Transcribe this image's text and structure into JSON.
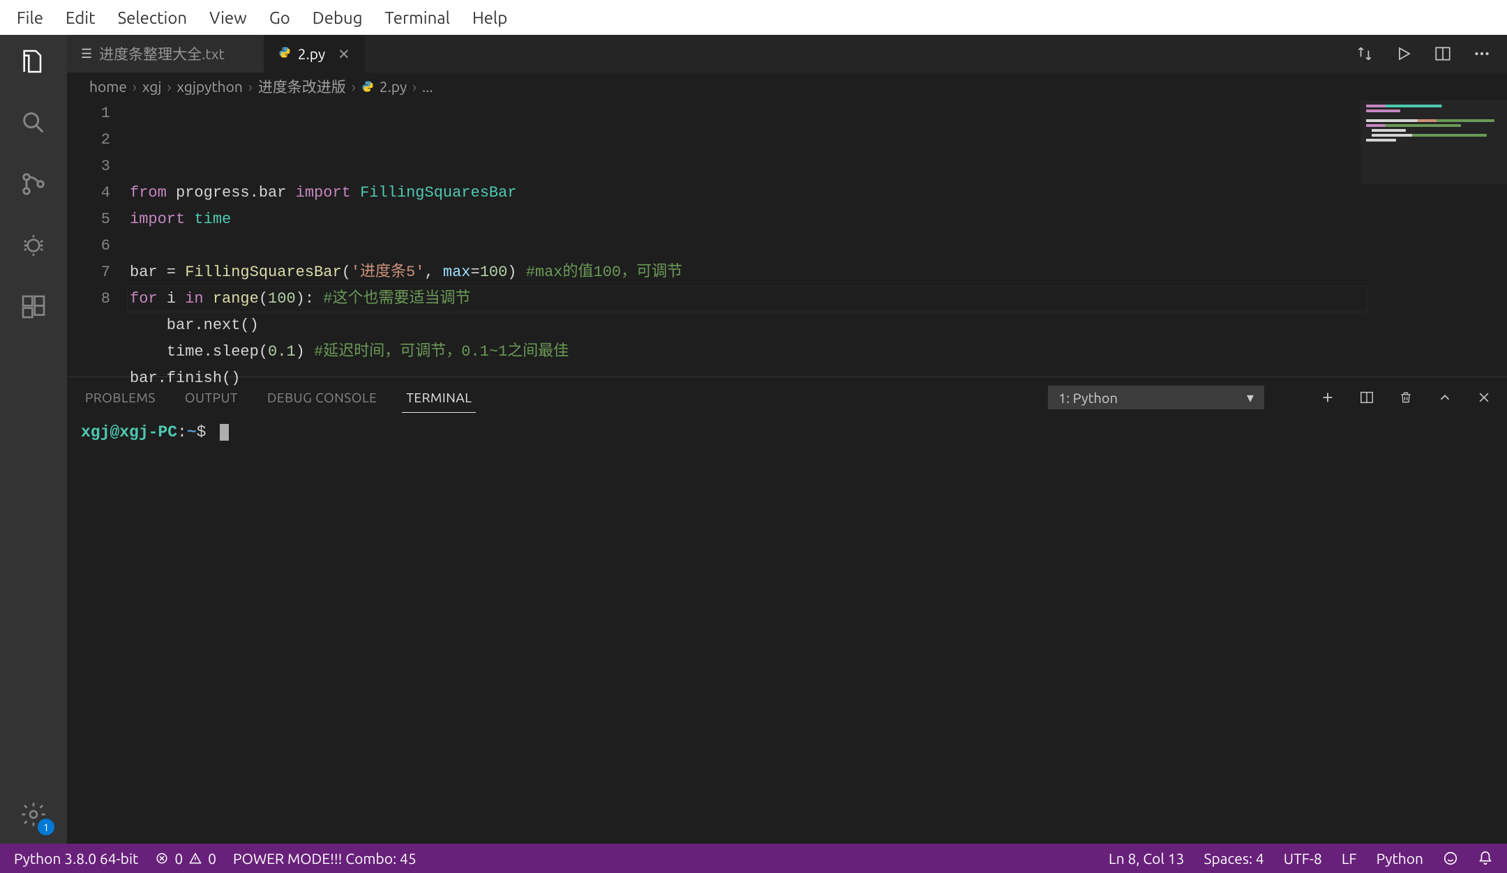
{
  "menu": [
    "File",
    "Edit",
    "Selection",
    "View",
    "Go",
    "Debug",
    "Terminal",
    "Help"
  ],
  "activity_badge": "1",
  "tabs": [
    {
      "label": "进度条整理大全.txt",
      "active": false,
      "icon": "list"
    },
    {
      "label": "2.py",
      "active": true,
      "icon": "python"
    }
  ],
  "breadcrumb": [
    "home",
    "xgj",
    "xgjpython",
    "进度条改进版",
    "2.py",
    "..."
  ],
  "code": {
    "lines": [
      {
        "n": "1",
        "segs": [
          {
            "t": "from ",
            "c": "tk-kw"
          },
          {
            "t": "progress.bar ",
            "c": ""
          },
          {
            "t": "import ",
            "c": "tk-kw"
          },
          {
            "t": "FillingSquaresBar",
            "c": "tk-cls"
          }
        ]
      },
      {
        "n": "2",
        "segs": [
          {
            "t": "import ",
            "c": "tk-kw"
          },
          {
            "t": "time",
            "c": "tk-cls"
          }
        ]
      },
      {
        "n": "3",
        "segs": [
          {
            "t": "",
            "c": ""
          }
        ]
      },
      {
        "n": "4",
        "segs": [
          {
            "t": "bar = ",
            "c": ""
          },
          {
            "t": "FillingSquaresBar",
            "c": "tk-fn"
          },
          {
            "t": "(",
            "c": ""
          },
          {
            "t": "'进度条5'",
            "c": "tk-str"
          },
          {
            "t": ", ",
            "c": ""
          },
          {
            "t": "max",
            "c": "tk-var"
          },
          {
            "t": "=",
            "c": ""
          },
          {
            "t": "100",
            "c": "tk-num"
          },
          {
            "t": ") ",
            "c": ""
          },
          {
            "t": "#max的值100，可调节",
            "c": "tk-cmt"
          }
        ]
      },
      {
        "n": "5",
        "segs": [
          {
            "t": "for ",
            "c": "tk-kw"
          },
          {
            "t": "i ",
            "c": ""
          },
          {
            "t": "in ",
            "c": "tk-kw"
          },
          {
            "t": "range",
            "c": "tk-fn"
          },
          {
            "t": "(",
            "c": ""
          },
          {
            "t": "100",
            "c": "tk-num"
          },
          {
            "t": "): ",
            "c": ""
          },
          {
            "t": "#这个也需要适当调节",
            "c": "tk-cmt"
          }
        ]
      },
      {
        "n": "6",
        "segs": [
          {
            "t": "    bar.next()",
            "c": ""
          }
        ]
      },
      {
        "n": "7",
        "segs": [
          {
            "t": "    time.sleep(",
            "c": ""
          },
          {
            "t": "0.1",
            "c": "tk-num"
          },
          {
            "t": ") ",
            "c": ""
          },
          {
            "t": "#延迟时间，可调节，0.1~1之间最佳",
            "c": "tk-cmt"
          }
        ]
      },
      {
        "n": "8",
        "segs": [
          {
            "t": "bar.finish()",
            "c": ""
          }
        ]
      }
    ]
  },
  "panel": {
    "tabs": [
      "PROBLEMS",
      "OUTPUT",
      "DEBUG CONSOLE",
      "TERMINAL"
    ],
    "active": "TERMINAL",
    "selector": "1: Python",
    "prompt": {
      "user": "xgj@xgj-PC",
      "path": "~",
      "sep": ":",
      "dollar": "$"
    }
  },
  "status": {
    "interpreter": "Python 3.8.0 64-bit",
    "errors": "0",
    "warnings": "0",
    "power": "POWER MODE!!! Combo: 45",
    "pos": "Ln 8, Col 13",
    "spaces": "Spaces: 4",
    "encoding": "UTF-8",
    "eol": "LF",
    "lang": "Python"
  }
}
